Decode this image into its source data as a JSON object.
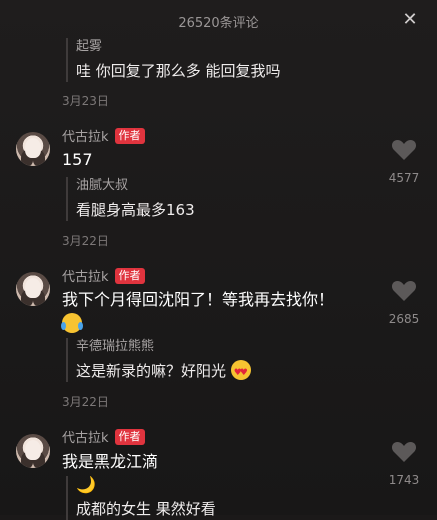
{
  "header": {
    "title": "26520条评论",
    "close_icon": "close-icon"
  },
  "top_reply": {
    "name": "起雾",
    "text": "哇 你回复了那么多 能回复我吗",
    "date": "3月23日"
  },
  "comments": [
    {
      "author": "代古拉k",
      "badge": "作者",
      "text": "157",
      "likes": "4577",
      "reply": {
        "name": "油腻大叔",
        "text": "看腿身高最多163"
      },
      "date": "3月22日"
    },
    {
      "author": "代古拉k",
      "badge": "作者",
      "text": "我下个月得回沈阳了！等我再去找你！",
      "likes": "2685",
      "reply": {
        "name": "辛德瑞拉熊熊",
        "text": "这是新录的嘛？好阳光"
      },
      "date": "3月22日"
    },
    {
      "author": "代古拉k",
      "badge": "作者",
      "text": "我是黑龙江滴",
      "likes": "1743",
      "reply": {
        "name": "",
        "text": "成都的女生 果然好看"
      }
    }
  ]
}
